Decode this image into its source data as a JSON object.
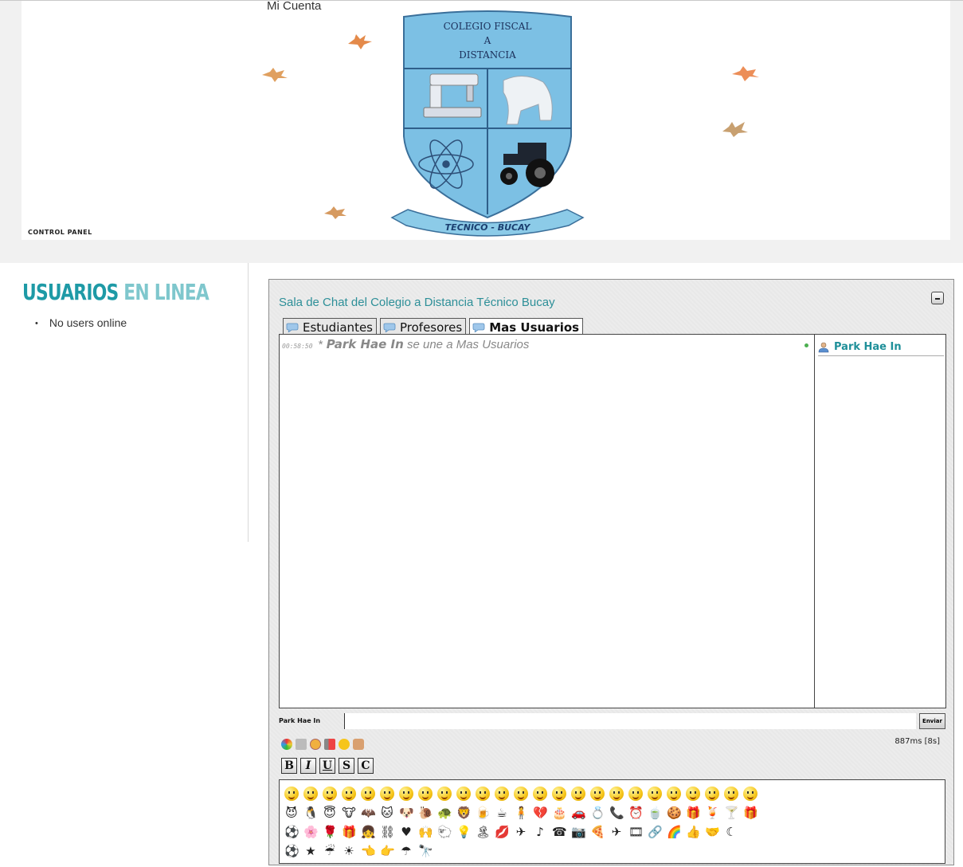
{
  "header": {
    "account_link": "Mi Cuenta",
    "control_panel": "CONTROL PANEL",
    "crest": {
      "line1": "COLEGIO FISCAL",
      "line2": "A",
      "line3": "DISTANCIA",
      "ribbon": "TECNICO - BUCAY"
    }
  },
  "sidebar": {
    "title_part1": "USUARIOS",
    "title_part2": "EN LINEA",
    "items": [
      "No users online"
    ]
  },
  "chat": {
    "title": "Sala de Chat del Colegio a Distancia Técnico Bucay",
    "tabs": [
      {
        "label": "Estudiantes",
        "active": false
      },
      {
        "label": "Profesores",
        "active": false
      },
      {
        "label": "Mas Usuarios",
        "active": true
      }
    ],
    "messages": [
      {
        "time": "00:58:50",
        "prefix": "*",
        "nick": "Park Hae In",
        "text": "se une a Mas Usuarios"
      }
    ],
    "users": [
      "Park Hae In"
    ],
    "input": {
      "nick": "Park Hae In",
      "value": "",
      "send_label": "Enviar"
    },
    "latency": "887ms [8s]",
    "tools": [
      "color-icon",
      "print-icon",
      "help-icon",
      "sound-icon",
      "emoticon-icon",
      "user-icon"
    ],
    "format_buttons": [
      "B",
      "I",
      "U",
      "S",
      "C"
    ],
    "smiley_rows": [
      [
        "smile",
        "sad",
        "happy",
        "tongue",
        "wink",
        "cry",
        "cool",
        "surprised",
        "angry",
        "sunglasses",
        "grin",
        "confused",
        "embarrassed",
        "blush",
        "laugh",
        "teeth",
        "sleepy",
        "shy",
        "sick",
        "smirk",
        "nerd",
        "party",
        "kiss",
        "thinking",
        "nauseous"
      ],
      [
        "devil",
        "penguin",
        "angel",
        "viking",
        "bat",
        "cat",
        "dog",
        "snail",
        "turtle",
        "lion",
        "drink",
        "coffee",
        "boy",
        "heart-broken",
        "cake",
        "car",
        "ring",
        "phone",
        "clock",
        "tea",
        "cookie",
        "present",
        "cocktail",
        "martini",
        "gift"
      ],
      [
        "soccer",
        "flower",
        "rose",
        "gift2",
        "girl",
        "cuffs",
        "heart",
        "hands",
        "sheep",
        "bulb",
        "island",
        "kiss-lips",
        "plane",
        "note",
        "phone2",
        "camera",
        "pizza",
        "jet",
        "film",
        "connect",
        "rainbow",
        "thumbs",
        "handshake",
        "moon"
      ],
      [
        "ball",
        "star",
        "rain",
        "sun",
        "left-hand",
        "right-hand",
        "umbrella",
        "binoculars"
      ]
    ]
  }
}
